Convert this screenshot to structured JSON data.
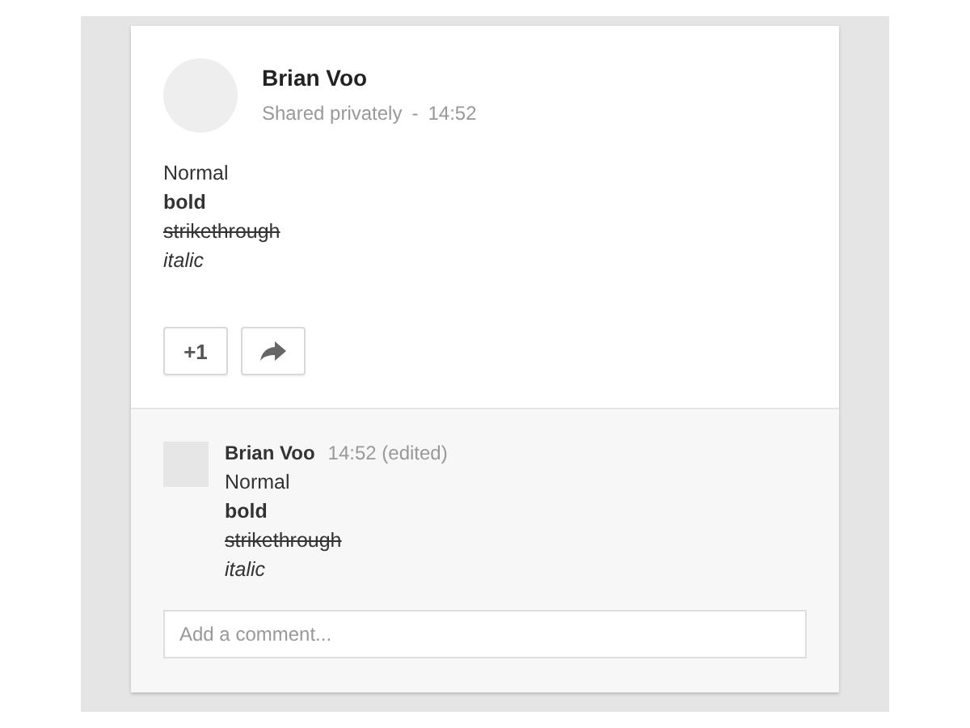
{
  "post": {
    "author": "Brian Voo",
    "visibility": "Shared privately",
    "separator": "-",
    "time": "14:52",
    "lines": [
      {
        "text": "Normal",
        "kind": "normal"
      },
      {
        "text": "bold",
        "kind": "bold"
      },
      {
        "text": "strikethrough",
        "kind": "strike"
      },
      {
        "text": "italic",
        "kind": "italic"
      }
    ],
    "plus_button": "+1"
  },
  "comment": {
    "author": "Brian Voo",
    "time": "14:52 (edited)",
    "lines": [
      {
        "text": "Normal",
        "kind": "normal"
      },
      {
        "text": "bold",
        "kind": "bold"
      },
      {
        "text": "strikethrough",
        "kind": "strike"
      },
      {
        "text": "italic",
        "kind": "italic"
      }
    ]
  },
  "comment_field": {
    "placeholder": "Add a comment..."
  }
}
